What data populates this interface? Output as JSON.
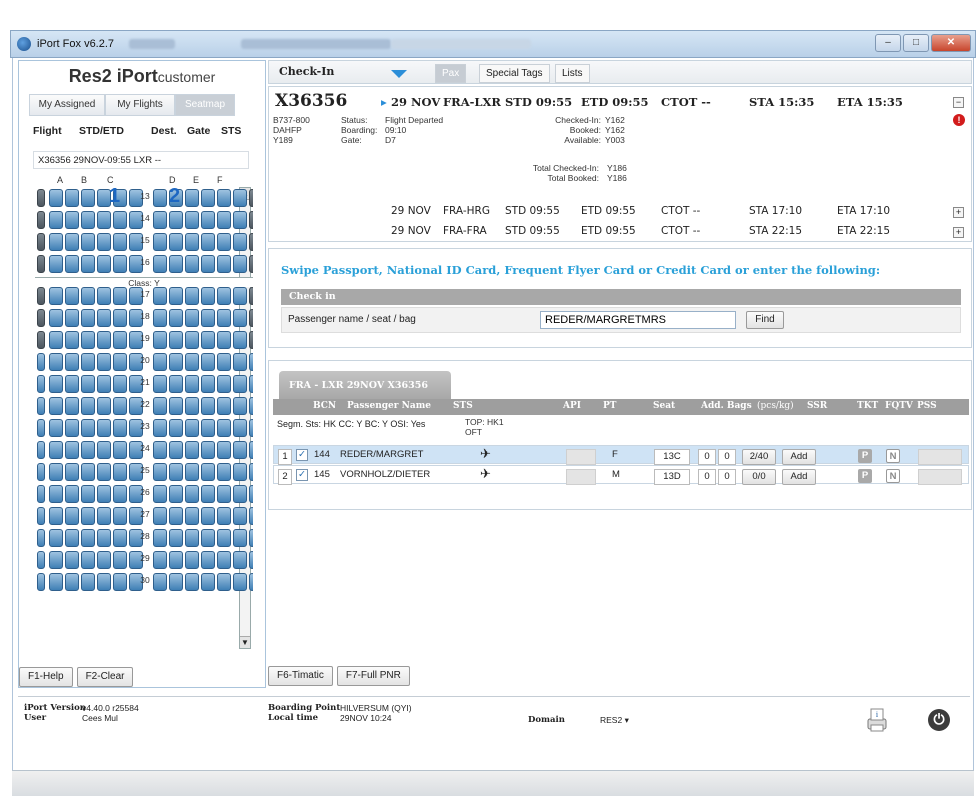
{
  "window": {
    "title": "iPort Fox v6.2.7"
  },
  "brand": {
    "part1": "Res2",
    "part2": " iPort",
    "part3": "customer"
  },
  "left_tabs": [
    {
      "label": "My Assigned"
    },
    {
      "label": "My Flights"
    },
    {
      "label": "Seatmap"
    }
  ],
  "flight_list": {
    "headers": [
      "Flight",
      "STD/ETD",
      "Dest.",
      "Gate",
      "STS"
    ],
    "row": "X36356    29NOV-09:55  LXR  --"
  },
  "seatmap": {
    "columns": [
      "A",
      "B",
      "C",
      "D",
      "E",
      "F"
    ],
    "rows": [
      "13",
      "14",
      "15",
      "16",
      "17",
      "18",
      "19",
      "20",
      "21",
      "22",
      "23",
      "24",
      "25",
      "26",
      "27",
      "28",
      "29",
      "30"
    ],
    "class_label": "Class: Y",
    "big_numbers": [
      "1",
      "2"
    ]
  },
  "left_buttons": [
    {
      "label": "F1-Help"
    },
    {
      "label": "F2-Clear"
    }
  ],
  "topbar": {
    "title": "Check-In",
    "tabs": [
      {
        "label": "Pax"
      },
      {
        "label": "Special Tags"
      },
      {
        "label": "Lists"
      }
    ]
  },
  "flight": {
    "number": "X36356",
    "aircraft": [
      "B737-800",
      "DAHFP",
      "Y189"
    ],
    "status_labels": [
      "Status:",
      "Boarding:",
      "Gate:"
    ],
    "status_values": [
      "Flight Departed",
      "09:10",
      "D7"
    ],
    "counts_labels": [
      "Checked-In:",
      "Booked:",
      "Available:"
    ],
    "counts_values": [
      "Y162",
      "Y162",
      "Y003"
    ],
    "totals_labels": [
      "Total Checked-In:",
      "Total Booked:"
    ],
    "totals_values": [
      "Y186",
      "Y186"
    ],
    "segments": [
      {
        "date": "29 NOV",
        "route": "FRA-LXR",
        "std": "STD 09:55",
        "etd": "ETD 09:55",
        "ctot": "CTOT --",
        "sta": "STA 15:35",
        "eta": "ETA 15:35",
        "btn": "−"
      },
      {
        "date": "29 NOV",
        "route": "FRA-HRG",
        "std": "STD 09:55",
        "etd": "ETD 09:55",
        "ctot": "CTOT --",
        "sta": "STA 17:10",
        "eta": "ETA 17:10",
        "btn": "+"
      },
      {
        "date": "29 NOV",
        "route": "FRA-FRA",
        "std": "STD 09:55",
        "etd": "ETD 09:55",
        "ctot": "CTOT --",
        "sta": "STA 22:15",
        "eta": "ETA 22:15",
        "btn": "+"
      }
    ],
    "alert": "!"
  },
  "swipe": {
    "message": "Swipe Passport, National ID Card, Frequent Flyer Card or Credit Card or enter the following:",
    "section": "Check in",
    "field_label": "Passenger name / seat / bag",
    "field_value": "REDER/MARGRETMRS",
    "find_label": "Find"
  },
  "pax": {
    "tab": "FRA - LXR 29NOV X36356",
    "headers": [
      "BCN",
      "Passenger Name",
      "STS",
      "API",
      "PT",
      "Seat",
      "Add. Bags",
      "(pcs/kg)",
      "SSR",
      "TKT",
      "FQTV",
      "PSS"
    ],
    "segline": "Segm. Sts: HK   CC: Y   BC: Y   OSI: Yes",
    "top_note": "TOP: HK1",
    "top_note2": "OFT",
    "rows": [
      {
        "idx": "1",
        "check": "✓",
        "bcn": "144",
        "name": "REDER/MARGRET",
        "sts": "✈",
        "pt": "F",
        "seat": "13C",
        "b1": "0",
        "b2": "0",
        "kg": "2/40",
        "ssr": "Add",
        "tkt": "P",
        "fqtv": "N"
      },
      {
        "idx": "2",
        "check": "✓",
        "bcn": "145",
        "name": "VORNHOLZ/DIETER",
        "sts": "✈",
        "pt": "M",
        "seat": "13D",
        "b1": "0",
        "b2": "0",
        "kg": "0/0",
        "ssr": "Add",
        "tkt": "P",
        "fqtv": "N"
      }
    ]
  },
  "right_buttons": [
    {
      "label": "F6-Timatic"
    },
    {
      "label": "F7-Full PNR"
    }
  ],
  "status": {
    "version_label": "iPort Version",
    "version_value": "v4.40.0 r25584",
    "user_label": "User",
    "user_value": "Cees Mul",
    "bp_label": "Boarding Point",
    "bp_value": "HILVERSUM (QYI)",
    "lt_label": "Local time",
    "lt_value": "29NOV 10:24",
    "domain_label": "Domain",
    "domain_value": "RES2 ▾"
  },
  "colors": {
    "accent": "#2aa0d8",
    "seat": "#3f7fb5",
    "header_grey": "#9e9e9e"
  }
}
